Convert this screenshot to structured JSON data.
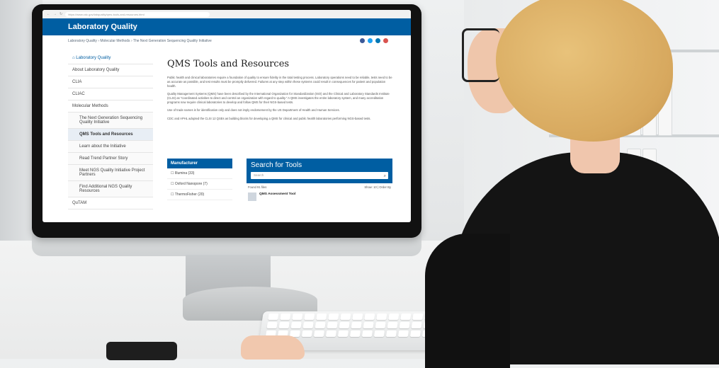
{
  "browser": {
    "url": "https://www.cdc.gov/labquality/qms-tools-and-resources.html"
  },
  "site": {
    "title": "Laboratory Quality",
    "breadcrumb": [
      "Laboratory Quality",
      "Molecular Methods",
      "The Next Generation Sequencing Quality Initiative"
    ],
    "social_icons": [
      "facebook-icon",
      "twitter-icon",
      "linkedin-icon",
      "email-icon"
    ]
  },
  "sidebar": {
    "items": [
      {
        "label": "Laboratory Quality"
      },
      {
        "label": "About Laboratory Quality"
      },
      {
        "label": "CLIA"
      },
      {
        "label": "CLIAC"
      },
      {
        "label": "Molecular Methods"
      },
      {
        "label": "The Next Generation Sequencing Quality Initiative"
      },
      {
        "label": "QMS Tools and Resources"
      },
      {
        "label": "Learn about the Initiative"
      },
      {
        "label": "Read Trend Partner Story"
      },
      {
        "label": "Meet NGS Quality Initiative Project Partners"
      },
      {
        "label": "Find Additional NGS Quality Resources"
      },
      {
        "label": "QuTAM"
      }
    ]
  },
  "main": {
    "title": "QMS Tools and Resources",
    "paragraphs": [
      "Public health and clinical laboratories require a foundation of quality to ensure fidelity in the total testing process. Laboratory operations need to be reliable, tests need to be as accurate as possible, and test results must be promptly delivered. Failures at any step within these systems could result in consequences for patient and population health.",
      "Quality Management Systems (QMS) have been described by the International Organization for Standardization (ISO) and the Clinical and Laboratory Standards Institute (CLSI) as \"coordinated activities to direct and control an organization with regard to quality.\" A QMS investigates the entire laboratory system, and many accreditation programs now require clinical laboratories to develop and follow QMS for their NGS-based tests.",
      "Use of trade names is for identification only and does not imply endorsement by the US Department of Health and Human Services.",
      "CDC and APHL adopted the CLSI 12 QSEs as building blocks for developing a QMS for clinical and public health laboratories performing NGS-based tests."
    ]
  },
  "manufacturer": {
    "heading": "Manufacturer",
    "items": [
      "Illumina (33)",
      "Oxford Nanopore (7)",
      "ThermoFisher (20)"
    ]
  },
  "search": {
    "heading": "Search for Tools",
    "placeholder": "Search",
    "found": "Found 91 files",
    "show": "Show: 10 | Order By",
    "first_result": "QMS Assessment Tool"
  }
}
